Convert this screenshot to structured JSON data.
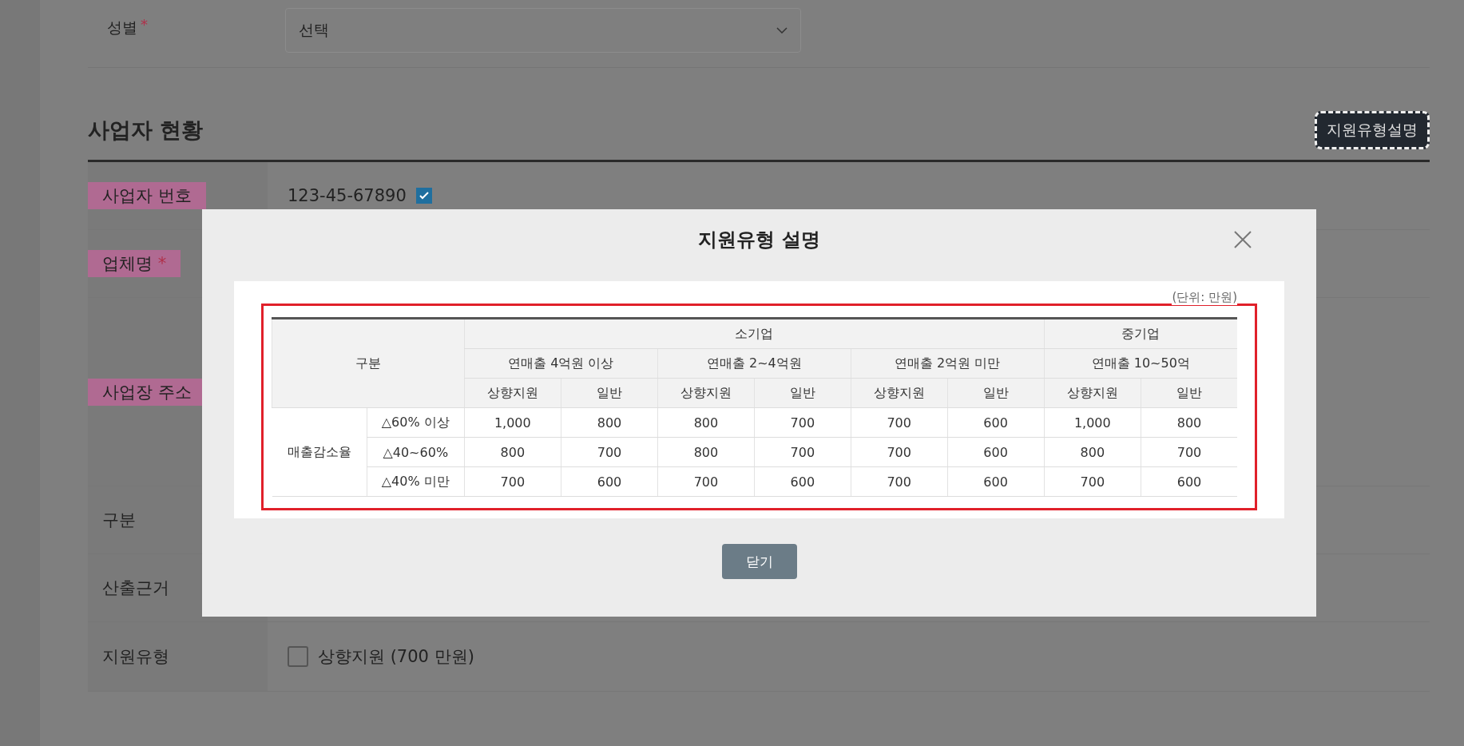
{
  "form_top": {
    "label": "성별",
    "required_mark": "*",
    "select": {
      "value": "선택"
    }
  },
  "section": {
    "title": "사업자 현황",
    "button": "지원유형설명"
  },
  "fields": [
    {
      "label": "사업자 번호",
      "highlighted": true,
      "value": "123-45-67890",
      "checked": true
    },
    {
      "label": "업체명",
      "required_mark": "*",
      "highlighted": true
    },
    {
      "label": "사업장 주소",
      "highlighted": true
    },
    {
      "label": "구분",
      "highlighted": false
    },
    {
      "label": "산출근거",
      "highlighted": false
    },
    {
      "label": "지원유형",
      "highlighted": false,
      "option": {
        "label": "상향지원 (700 만원)",
        "checked": false
      }
    }
  ],
  "modal": {
    "title": "지원유형 설명",
    "unit": "(단위: 만원)",
    "table": {
      "corner": "구분",
      "groups": [
        {
          "label": "소기업",
          "bands": [
            "연매출 4억원 이상",
            "연매출 2~4억원",
            "연매출 2억원 미만"
          ]
        },
        {
          "label": "중기업",
          "bands": [
            "연매출 10~50억"
          ]
        }
      ],
      "subheads": [
        "상향지원",
        "일반",
        "상향지원",
        "일반",
        "상향지원",
        "일반",
        "상향지원",
        "일반"
      ],
      "row_group": "매출감소율",
      "rows": [
        {
          "label": "△60% 이상",
          "values": [
            "1,000",
            "800",
            "800",
            "700",
            "700",
            "600",
            "1,000",
            "800"
          ]
        },
        {
          "label": "△40~60%",
          "values": [
            "800",
            "700",
            "800",
            "700",
            "700",
            "600",
            "800",
            "700"
          ]
        },
        {
          "label": "△40% 미만",
          "values": [
            "700",
            "600",
            "700",
            "600",
            "700",
            "600",
            "700",
            "600"
          ]
        }
      ]
    },
    "close_button": "닫기"
  }
}
